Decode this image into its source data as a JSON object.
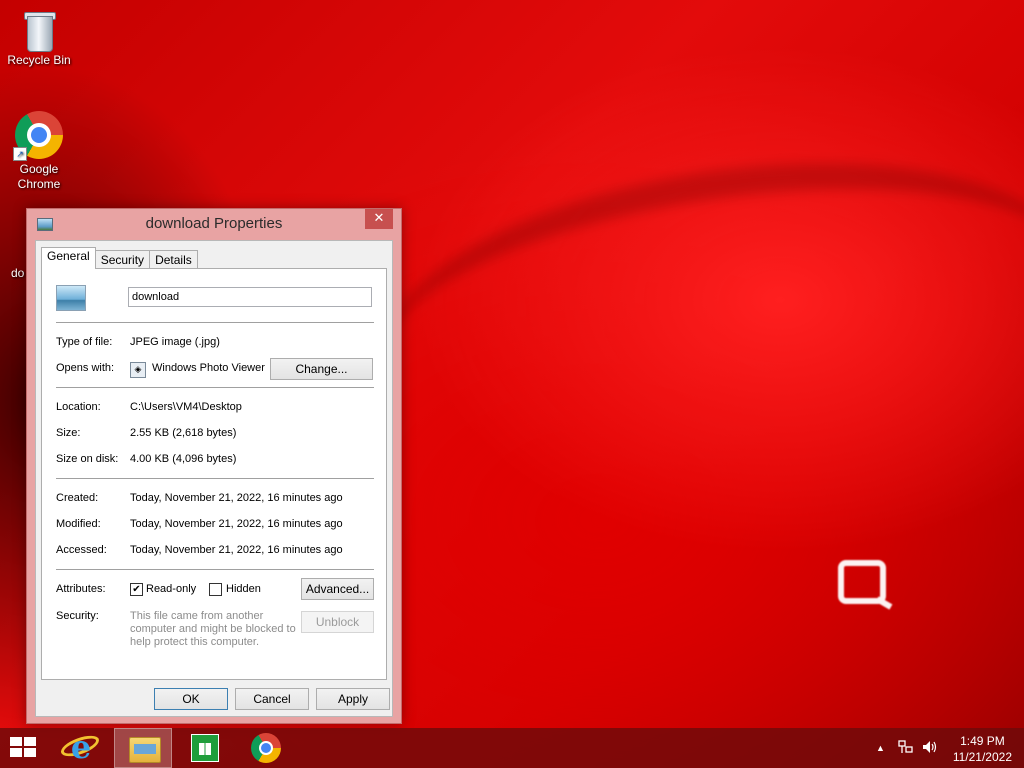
{
  "desktop": {
    "icons": [
      {
        "label": "Recycle Bin",
        "icon": "recycle-bin-icon"
      },
      {
        "label": "Google Chrome",
        "icon": "chrome-icon"
      }
    ],
    "partial_label": "do"
  },
  "window": {
    "title": "download Properties",
    "close_glyph": "✕",
    "tabs": [
      "General",
      "Security",
      "Details"
    ],
    "active_tab": "General",
    "file_name": "download",
    "fields": {
      "type_label": "Type of file:",
      "type_value": "JPEG image (.jpg)",
      "opens_label": "Opens with:",
      "opens_value": "Windows Photo Viewer",
      "change_button": "Change...",
      "location_label": "Location:",
      "location_value": "C:\\Users\\VM4\\Desktop",
      "size_label": "Size:",
      "size_value": "2.55 KB (2,618 bytes)",
      "size_disk_label": "Size on disk:",
      "size_disk_value": "4.00 KB (4,096 bytes)",
      "created_label": "Created:",
      "created_value": "Today, November 21, 2022, 16 minutes ago",
      "modified_label": "Modified:",
      "modified_value": "Today, November 21, 2022, 16 minutes ago",
      "accessed_label": "Accessed:",
      "accessed_value": "Today, November 21, 2022, 16 minutes ago",
      "attributes_label": "Attributes:",
      "readonly_label": "Read-only",
      "readonly_checked": true,
      "hidden_label": "Hidden",
      "hidden_checked": false,
      "advanced_button": "Advanced...",
      "security_label": "Security:",
      "security_text_1": "This file came from another",
      "security_text_2": "computer and might be blocked to",
      "security_text_3": "help protect this computer.",
      "unblock_button": "Unblock"
    },
    "buttons": {
      "ok": "OK",
      "cancel": "Cancel",
      "apply": "Apply"
    }
  },
  "taskbar": {
    "items": [
      "start-icon",
      "internet-explorer-icon",
      "file-explorer-icon",
      "store-icon",
      "chrome-icon"
    ],
    "active_item": "file-explorer-icon",
    "tray": {
      "show_hidden_glyph": "▲",
      "time": "1:49 PM",
      "date": "11/21/2022"
    }
  },
  "colors": {
    "wallpaper": "#d00000",
    "window_frame": "#e8a3a3",
    "close_button": "#c7504f",
    "taskbar": "#6e0a0a"
  }
}
